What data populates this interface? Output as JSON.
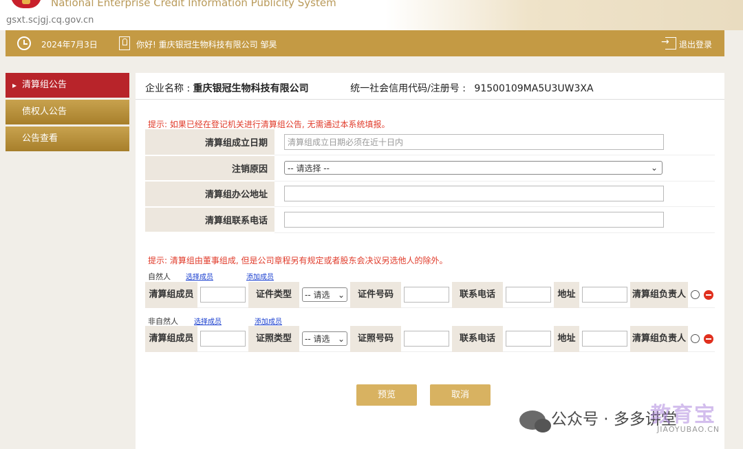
{
  "header": {
    "site_title_en": "National Enterprise Credit Information Publicity System",
    "url": "gsxt.scjgj.cq.gov.cn"
  },
  "topbar": {
    "date": "2024年7月3日",
    "greeting": "你好! 重庆银冠生物科技有限公司  邹昊",
    "logout": "退出登录"
  },
  "sidebar": {
    "items": [
      {
        "label": "清算组公告"
      },
      {
        "label": "债权人公告"
      },
      {
        "label": "公告查看"
      }
    ]
  },
  "main": {
    "company_label": "企业名称 :",
    "company_name": "重庆银冠生物科技有限公司",
    "code_label": "统一社会信用代码/注册号 :",
    "code_value": "91500109MA5U3UW3XA",
    "tip1": "提示: 如果已经在登记机关进行清算组公告, 无需通过本系统填报。",
    "fields": {
      "date_label": "清算组成立日期",
      "date_placeholder": "清算组成立日期必须在近十日内",
      "reason_label": "注销原因",
      "reason_select": "-- 请选择 --",
      "address_label": "清算组办公地址",
      "phone_label": "清算组联系电话"
    },
    "tip2": "提示: 清算组由董事组成, 但是公司章程另有规定或者股东会决议另选他人的除外。",
    "natural": {
      "label": "自然人",
      "select_member": "选择成员",
      "add_member": "添加成员",
      "cols": [
        "清算组成员",
        "证件类型",
        "证件号码",
        "联系电话",
        "地址",
        "清算组负责人"
      ],
      "select_text": "-- 请选"
    },
    "nonnatural": {
      "label": "非自然人",
      "select_member": "选择成员",
      "add_member": "添加成员",
      "cols": [
        "清算组成员",
        "证照类型",
        "证照号码",
        "联系电话",
        "地址",
        "清算组负责人"
      ],
      "select_text": "-- 请选"
    },
    "buttons": {
      "preview": "预览",
      "cancel": "取消"
    }
  },
  "watermark": {
    "text": "公众号 · 多多讲堂",
    "brand": "教育宝",
    "brand_url": "JIAOYUBAO.CN"
  },
  "colors": {
    "gold": "#c49a44",
    "active_red": "#b8242a",
    "tip_red": "#e03b2a",
    "label_bg": "#ede7de"
  }
}
